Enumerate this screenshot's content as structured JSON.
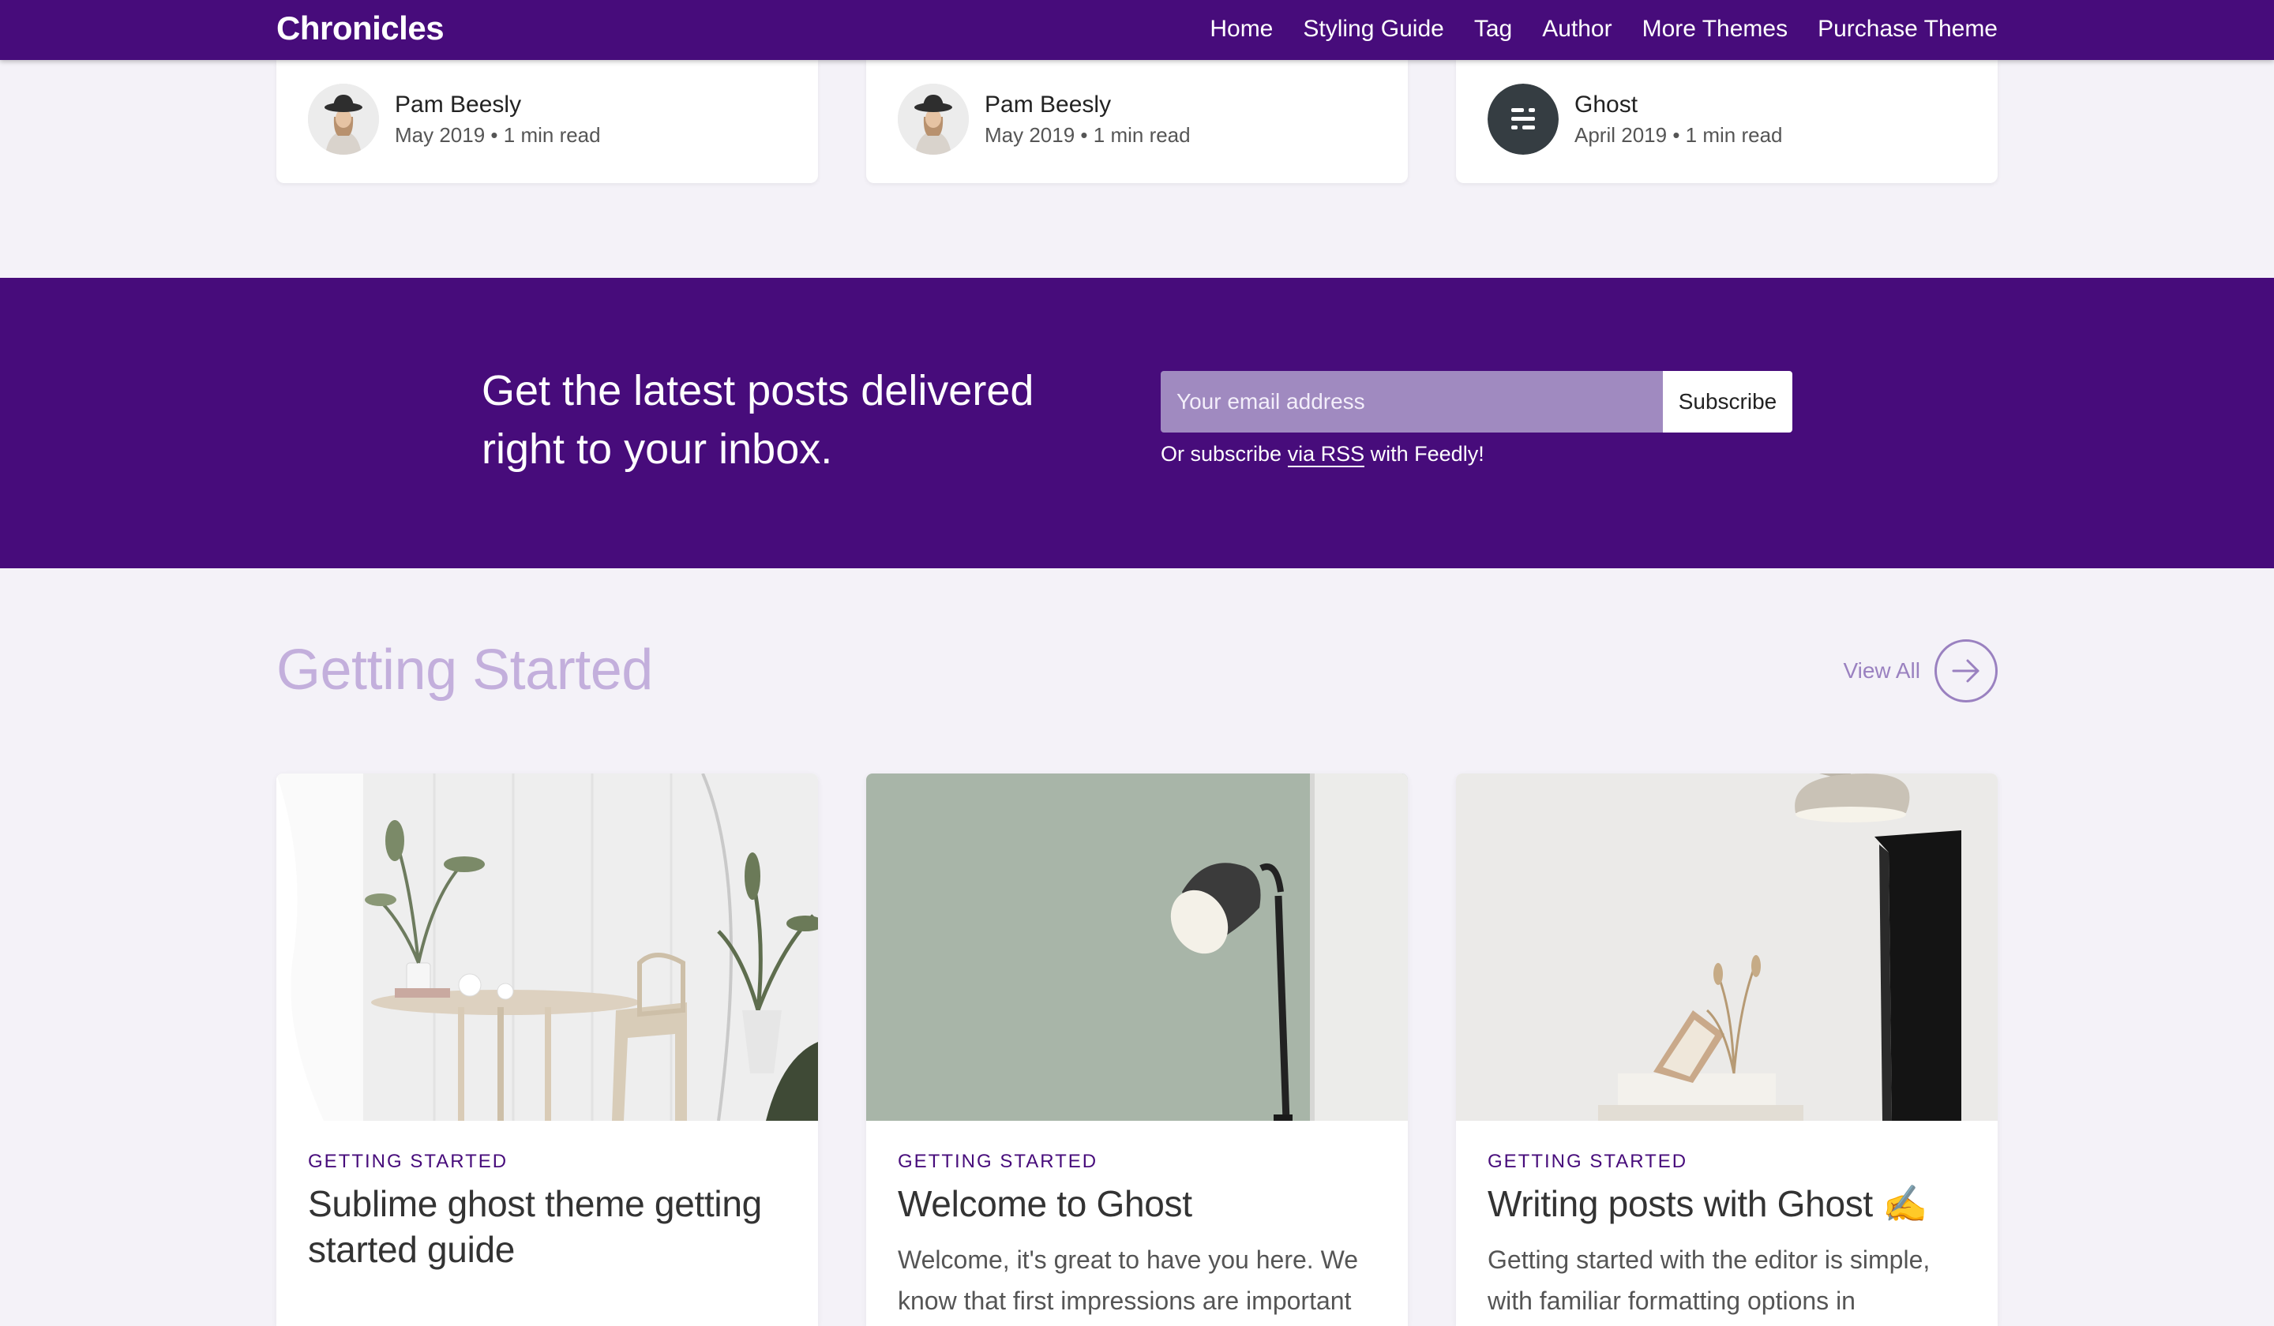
{
  "nav": {
    "brand": "Chronicles",
    "links": [
      "Home",
      "Styling Guide",
      "Tag",
      "Author",
      "More Themes",
      "Purchase Theme"
    ]
  },
  "authors": [
    {
      "name": "Pam Beesly",
      "date": "May 2019",
      "read": "1 min read",
      "avatar": "woman-with-hat-avatar"
    },
    {
      "name": "Pam Beesly",
      "date": "May 2019",
      "read": "1 min read",
      "avatar": "woman-with-hat-avatar"
    },
    {
      "name": "Ghost",
      "date": "April 2019",
      "read": "1 min read",
      "avatar": "ghost-logo-icon"
    }
  ],
  "separator": "•",
  "subscribe": {
    "heading": "Get the latest posts delivered right to your inbox.",
    "placeholder": "Your email address",
    "button": "Subscribe",
    "note_prefix": "Or subscribe",
    "note_link": "via RSS",
    "note_suffix": "with Feedly!"
  },
  "section": {
    "title": "Getting Started",
    "view_all": "View All",
    "icon": "arrow-right-icon"
  },
  "posts": [
    {
      "tag": "GETTING STARTED",
      "title": "Sublime ghost theme getting started guide",
      "excerpt": ""
    },
    {
      "tag": "GETTING STARTED",
      "title": "Welcome to Ghost",
      "excerpt": "Welcome, it's great to have you here. We know that first impressions are important"
    },
    {
      "tag": "GETTING STARTED",
      "title": "Writing posts with Ghost ✍️",
      "excerpt": "Getting started with the editor is simple, with familiar formatting options in"
    }
  ],
  "colors": {
    "brand": "#470c7b",
    "section_title": "#c3afdc",
    "view_all": "#9a81c0",
    "background": "#f4f2f8"
  }
}
